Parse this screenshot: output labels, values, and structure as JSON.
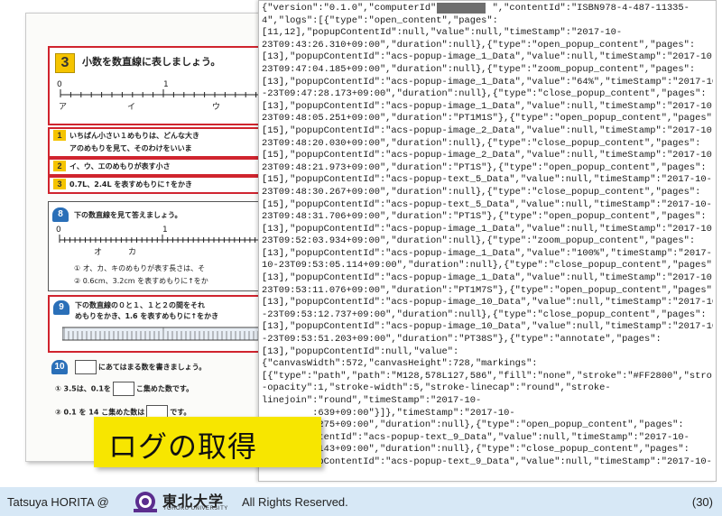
{
  "textbook": {
    "q3": {
      "number": "3",
      "title": "小数を数直線に表しましょう。"
    },
    "numline1": {
      "zero": "0",
      "one": "1",
      "labels": [
        "ア",
        "イ",
        "ウ"
      ]
    },
    "sub1": {
      "badge": "1",
      "line1": "いちばん小さい１めもりは、どんな大き",
      "line2": "アのめもりを見て、そのわけをいいま"
    },
    "sub2": {
      "badge": "2",
      "text": "イ、ウ、エのめもりが表す小さ"
    },
    "sub3": {
      "badge": "3",
      "text": "0.7L、2.4L を表すめもりに↑をかき"
    },
    "q8": {
      "number": "8",
      "title": "下の数直線を見て答えましょう。",
      "axis": {
        "zero": "0",
        "one": "1",
        "labels": [
          "オ",
          "カ"
        ]
      },
      "item1": "① オ、カ、キのめもりが表す長さは、そ",
      "item2": "② 0.6cm、3.2cm を表すめもりに↑をか"
    },
    "q9": {
      "number": "9",
      "line1": "下の数直線の０と１、１と２の間をそれ",
      "line2": "めもりをかき、1.6 を表すめもりに↑をかき",
      "tick0": "0",
      "tick1": "1"
    },
    "q10": {
      "number": "10",
      "title": "にあてはまる数を書きましょう。",
      "item1_pre": "① 3.5は、0.1を",
      "item1_post": "こ集めた数です。",
      "item2_pre": "② 0.1 を 14 こ集めた数は",
      "item2_post": "です。"
    }
  },
  "log": {
    "lines": [
      "{\"version\":\"0.1.0\",\"computerId\":\"        \",\"contentId\":\"ISBN978-4-487-11335-",
      "4\",\"logs\":[{\"type\":\"open_content\",\"pages\":",
      "[11,12],\"popupContentId\":null,\"value\":null,\"timeStamp\":\"2017-10-",
      "23T09:43:26.310+09:00\",\"duration\":null},{\"type\":\"open_popup_content\",\"pages\":",
      "[13],\"popupContentId\":\"acs-popup-image_1_Data\",\"value\":null,\"timeStamp\":\"2017-10-",
      "23T09:47:04.185+09:00\",\"duration\":null},{\"type\":\"zoom_popup_content\",\"pages\":",
      "[13],\"popupContentId\":\"acs-popup-image_1_Data\",\"value\":\"64%\",\"timeStamp\":\"2017-10",
      "-23T09:47:28.173+09:00\",\"duration\":null},{\"type\":\"close_popup_content\",\"pages\":",
      "[13],\"popupContentId\":\"acs-popup-image_1_Data\",\"value\":null,\"timeStamp\":\"2017-10-",
      "23T09:48:05.251+09:00\",\"duration\":\"PT1M1S\"},{\"type\":\"open_popup_content\",\"pages\":",
      "[15],\"popupContentId\":\"acs-popup-image_2_Data\",\"value\":null,\"timeStamp\":\"2017-10-",
      "23T09:48:20.030+09:00\",\"duration\":null},{\"type\":\"close_popup_content\",\"pages\":",
      "[15],\"popupContentId\":\"acs-popup-image_2_Data\",\"value\":null,\"timeStamp\":\"2017-10-",
      "23T09:48:21.973+09:00\",\"duration\":\"PT1S\"},{\"type\":\"open_popup_content\",\"pages\":",
      "[15],\"popupContentId\":\"acs-popup-text_5_Data\",\"value\":null,\"timeStamp\":\"2017-10-",
      "23T09:48:30.267+09:00\",\"duration\":null},{\"type\":\"close_popup_content\",\"pages\":",
      "[15],\"popupContentId\":\"acs-popup-text_5_Data\",\"value\":null,\"timeStamp\":\"2017-10-",
      "23T09:48:31.706+09:00\",\"duration\":\"PT1S\"},{\"type\":\"open_popup_content\",\"pages\":",
      "[13],\"popupContentId\":\"acs-popup-image_1_Data\",\"value\":null,\"timeStamp\":\"2017-10-",
      "23T09:52:03.934+09:00\",\"duration\":null},{\"type\":\"zoom_popup_content\",\"pages\":",
      "[13],\"popupContentId\":\"acs-popup-image_1_Data\",\"value\":\"100%\",\"timeStamp\":\"2017-",
      "10-23T09:53:05.114+09:00\",\"duration\":null},{\"type\":\"close_popup_content\",\"pages\":",
      "[13],\"popupContentId\":\"acs-popup-image_1_Data\",\"value\":null,\"timeStamp\":\"2017-10-",
      "23T09:53:11.076+09:00\",\"duration\":\"PT1M7S\"},{\"type\":\"open_popup_content\",\"pages\":",
      "[13],\"popupContentId\":\"acs-popup-image_10_Data\",\"value\":null,\"timeStamp\":\"2017-10",
      "-23T09:53:12.737+09:00\",\"duration\":null},{\"type\":\"close_popup_content\",\"pages\":",
      "[13],\"popupContentId\":\"acs-popup-image_10_Data\",\"value\":null,\"timeStamp\":\"2017-10",
      "-23T09:53:51.203+09:00\",\"duration\":\"PT38S\"},{\"type\":\"annotate\",\"pages\":",
      "[13],\"popupContentId\":null,\"value\":",
      "{\"canvasWidth\":572,\"canvasHeight\":728,\"markings\":",
      "[{\"type\":\"path\",\"path\":\"M128,578L127,586\",\"fill\":\"none\",\"stroke\":\"#FF2800\",\"stroke",
      "-opacity\":1,\"stroke-width\":5,\"stroke-linecap\":\"round\",\"stroke-",
      "linejoin\":\"round\",\"timeStamp\":\"2017-10-",
      "         :639+09:00\"}]},\"timeStamp\":\"2017-10-",
      "         :275+09:00\",\"duration\":null},{\"type\":\"open_popup_content\",\"pages\":",
      "         ntentId\":\"acs-popup-text_9_Data\",\"value\":null,\"timeStamp\":\"2017-10-",
      "         :143+09:00\",\"duration\":null},{\"type\":\"close_popup_content\",\"pages\":",
      "[13],\"popupContentId\":\"acs-popup-text_9_Data\",\"value\":null,\"timeStamp\":\"2017-10-"
    ]
  },
  "caption": "ログの取得",
  "footer": {
    "author": "Tatsuya HORITA @",
    "university_ja": "東北大学",
    "university_en": "TOHOKU UNIVERSITY",
    "rights": "All Rights Reserved.",
    "page": "(30)"
  },
  "colors": {
    "caption_bg": "#f7e600",
    "footer_bg": "#d7e8f6",
    "accent_red": "#d0242e",
    "badge_blue": "#2a6fb8"
  }
}
